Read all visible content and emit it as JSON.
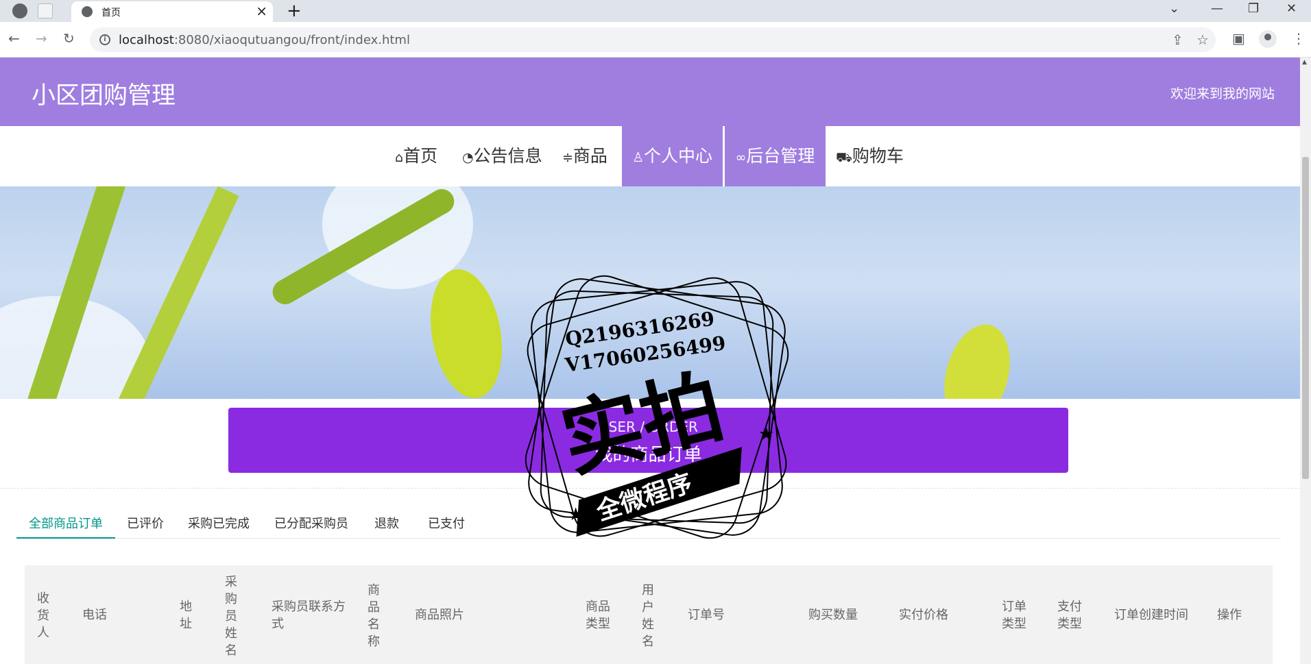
{
  "browser": {
    "tab_title": "首页",
    "url_host": "localhost",
    "url_rest": ":8080/xiaoqutuangou/front/index.html"
  },
  "header": {
    "site_title": "小区团购管理",
    "welcome": "欢迎来到我的网站",
    "bg_color": "#a07ee0"
  },
  "nav": {
    "items": [
      {
        "icon": "home-icon",
        "label": "首页"
      },
      {
        "icon": "gauge-icon",
        "label": "公告信息"
      },
      {
        "icon": "sliders-icon",
        "label": "商品"
      },
      {
        "icon": "user-icon",
        "label": "个人中心"
      },
      {
        "icon": "link-icon",
        "label": "后台管理"
      },
      {
        "icon": "cart-icon",
        "label": "购物车"
      }
    ]
  },
  "order_banner": {
    "title_en": "USER / ORDER",
    "title_zh": "我的商品订单",
    "color": "#8a2be2"
  },
  "order_tabs": [
    "全部商品订单",
    "已评价",
    "采购已完成",
    "已分配采购员",
    "退款",
    "已支付"
  ],
  "table": {
    "columns": [
      "收货人",
      "电话",
      "地址",
      "采购员姓名",
      "采购员联系方式",
      "商品名称",
      "商品照片",
      "商品类型",
      "用户姓名",
      "订单号",
      "购买数量",
      "实付价格",
      "订单类型",
      "支付类型",
      "订单创建时间",
      "操作"
    ]
  },
  "watermark": {
    "line1": "Q2196316269",
    "line2": "V17060256499",
    "big_text": "实拍",
    "ribbon": "全微程序"
  },
  "accent": "#009688"
}
